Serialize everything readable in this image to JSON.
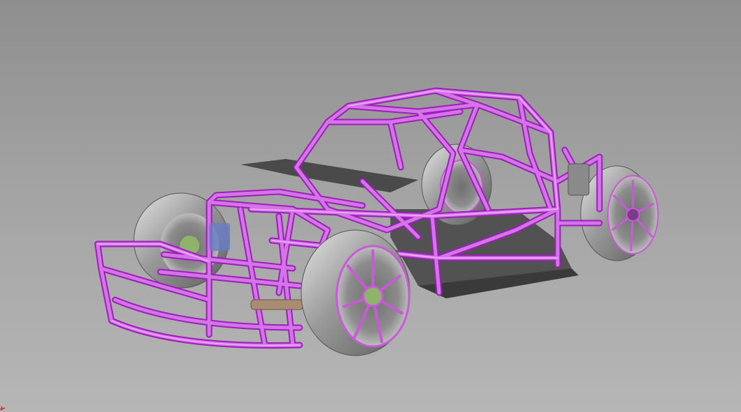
{
  "viewport": {
    "background_top": "#8e8e8e",
    "background_bottom": "#b6b6b6"
  },
  "model": {
    "frame_color": "#c85ad8",
    "frame_highlight": "#f2b8ff",
    "frame_outline": "#9b1fb8",
    "tire_color": "#8a8a8a",
    "tire_highlight": "#d6d6d6",
    "floor_color": "#4a4a4a",
    "hub_accent": "#8fb36a"
  },
  "axis_triad": {
    "icon": "axis-triad-icon",
    "color": "#d40000"
  }
}
